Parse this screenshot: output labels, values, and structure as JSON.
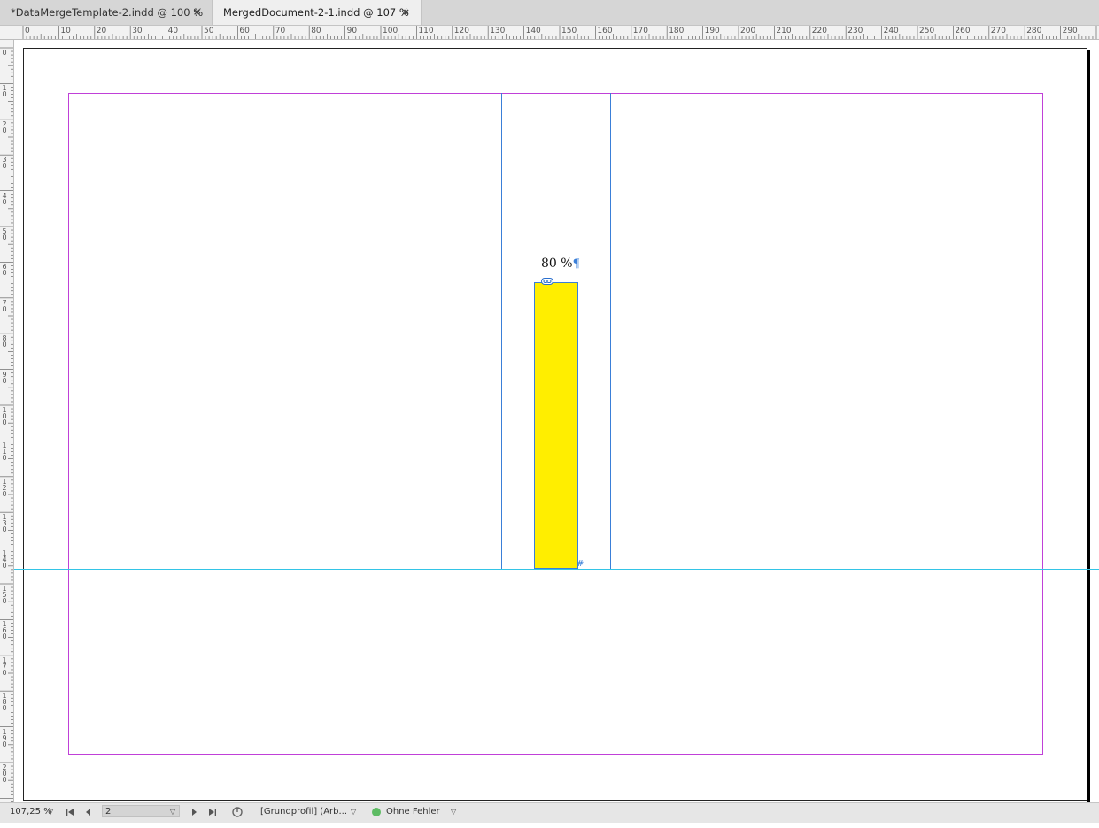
{
  "tabs": [
    {
      "label": "*DataMergeTemplate-2.indd @ 100 %",
      "active": false
    },
    {
      "label": "MergedDocument-2-1.indd @ 107 %",
      "active": true
    }
  ],
  "tab_close_glyph": "×",
  "ruler_h_labels": [
    "0",
    "10",
    "20",
    "30",
    "40",
    "50",
    "60",
    "70",
    "80",
    "90",
    "100",
    "110",
    "120",
    "130",
    "140",
    "150",
    "160",
    "170",
    "180",
    "190",
    "200",
    "210",
    "220",
    "230",
    "240",
    "250",
    "260",
    "270",
    "280",
    "290"
  ],
  "ruler_v_labels": [
    "0",
    "10",
    "20",
    "30",
    "40",
    "50",
    "60",
    "70",
    "80",
    "90",
    "100",
    "110",
    "120",
    "130",
    "140",
    "150",
    "160",
    "170",
    "180",
    "190",
    "200"
  ],
  "document": {
    "percent_text": "80 %",
    "pilcrow": "¶",
    "bar_fill_color": "#ffee00",
    "bar_value_percent": 80,
    "overset_marker": "#"
  },
  "statusbar": {
    "zoom": "107,25 %",
    "page_number": "2",
    "profile": "[Grundprofil] (Arb...",
    "preflight_status": "Ohne Fehler",
    "preflight_color": "#5dbb63"
  },
  "icons": {
    "first_page": "first-page-icon",
    "prev_page": "prev-page-icon",
    "next_page": "next-page-icon",
    "last_page": "last-page-icon",
    "preflight": "preflight-icon",
    "link": "link-icon"
  }
}
